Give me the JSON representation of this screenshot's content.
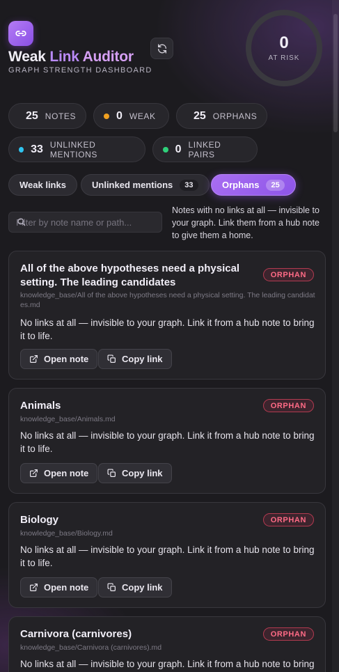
{
  "header": {
    "title_part1": "Weak",
    "title_part2": "Link",
    "title_part3": "Auditor",
    "subtitle": "GRAPH STRENGTH DASHBOARD",
    "app_icon": "link-icon",
    "refresh_icon": "refresh-icon"
  },
  "risk": {
    "value": "0",
    "label": "AT RISK"
  },
  "stats": [
    {
      "value": "25",
      "label": "NOTES",
      "color": "#9a98a0"
    },
    {
      "value": "0",
      "label": "WEAK",
      "color": "#f0a020"
    },
    {
      "value": "25",
      "label": "ORPHANS",
      "color": "#f0405a"
    },
    {
      "value": "33",
      "label": "UNLINKED MENTIONS",
      "color": "#2fc4f0"
    },
    {
      "value": "0",
      "label": "LINKED PAIRS",
      "color": "#2fd07a"
    }
  ],
  "tabs": [
    {
      "label": "Weak links",
      "count": ""
    },
    {
      "label": "Unlinked mentions",
      "count": "33"
    },
    {
      "label": "Orphans",
      "count": "25",
      "active": true
    }
  ],
  "filter": {
    "placeholder": "Filter by note name or path...",
    "help": "Notes with no links at all — invisible to your graph. Link them from a hub note to give them a home."
  },
  "accent_color": "#a96ef2",
  "orphan_badge": "ORPHAN",
  "open_label": "Open note",
  "copy_label": "Copy link",
  "cards": [
    {
      "name": "All of the above hypotheses need a physical setting. The leading candidates",
      "path": "knowledge_base/All of the above hypotheses need a physical setting. The leading candidates.md",
      "desc": "No links at all — invisible to your graph. Link it from a hub note to bring it to life."
    },
    {
      "name": "Animals",
      "path": "knowledge_base/Animals.md",
      "desc": "No links at all — invisible to your graph. Link it from a hub note to bring it to life."
    },
    {
      "name": "Biology",
      "path": "knowledge_base/Biology.md",
      "desc": "No links at all — invisible to your graph. Link it from a hub note to bring it to life."
    },
    {
      "name": "Carnivora (carnivores)",
      "path": "knowledge_base/Carnivora (carnivores).md",
      "desc": "No links at all — invisible to your graph. Link it from a hub note to bring it to life."
    }
  ]
}
